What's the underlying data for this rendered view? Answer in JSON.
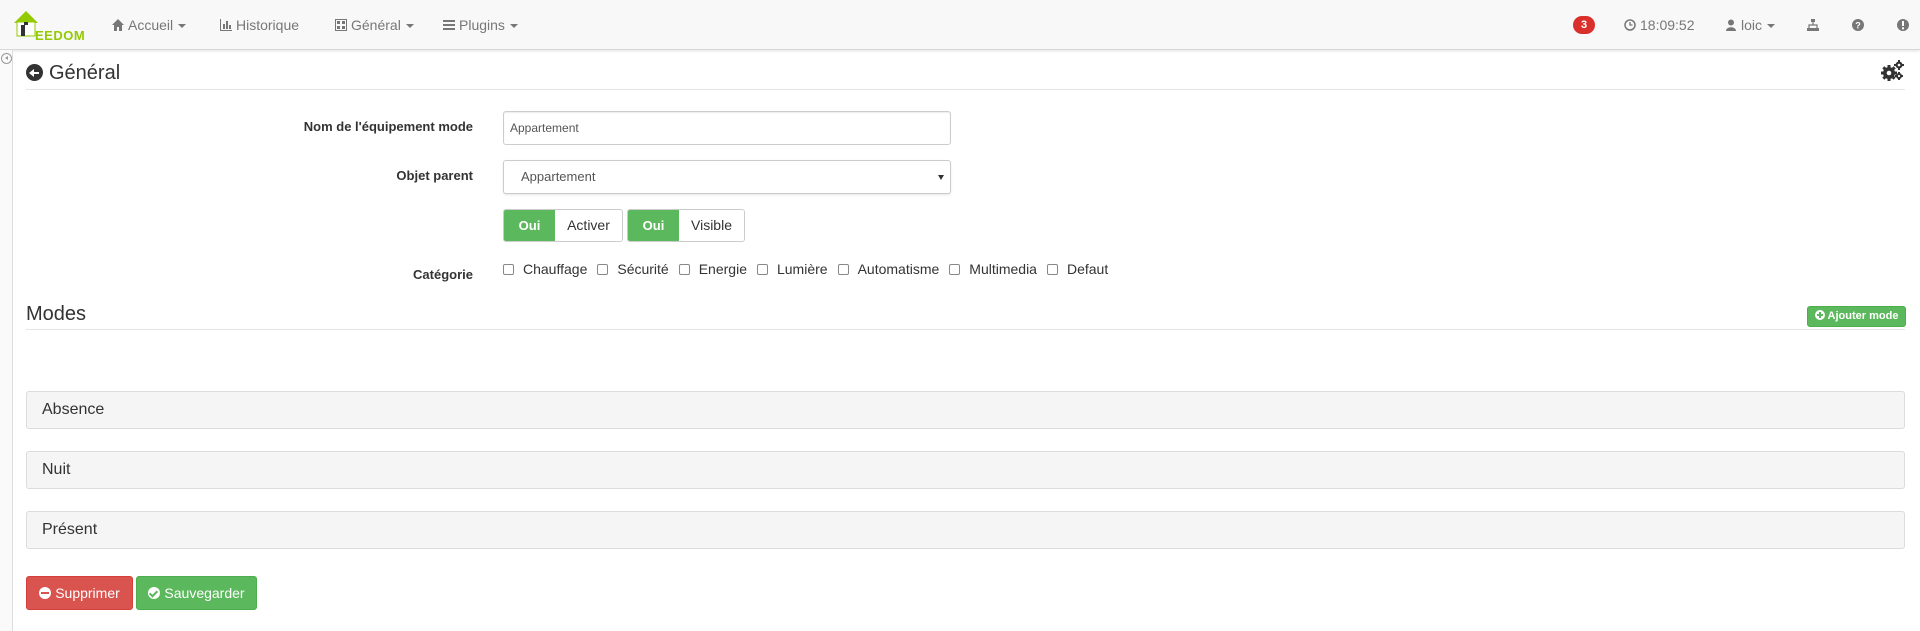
{
  "navbar": {
    "brand": "EEDOM",
    "accueil": "Accueil",
    "historique": "Historique",
    "general": "Général",
    "plugins": "Plugins",
    "notifications": "3",
    "time": "18:09:52",
    "user": "loic"
  },
  "page": {
    "title": "Général"
  },
  "form": {
    "name_label": "Nom de l'équipement mode",
    "name_value": "Appartement",
    "parent_label": "Objet parent",
    "parent_value": "Appartement",
    "toggle_enable": {
      "on": "Oui",
      "label": "Activer"
    },
    "toggle_visible": {
      "on": "Oui",
      "label": "Visible"
    },
    "category_label": "Catégorie",
    "categories": [
      "Chauffage",
      "Sécurité",
      "Energie",
      "Lumière",
      "Automatisme",
      "Multimedia",
      "Defaut"
    ]
  },
  "modes": {
    "title": "Modes",
    "add_button": "Ajouter mode",
    "items": [
      "Absence",
      "Nuit",
      "Présent"
    ]
  },
  "actions": {
    "delete": "Supprimer",
    "save": "Sauvegarder"
  },
  "colors": {
    "success": "#5cb85c",
    "danger": "#d9534f",
    "badge": "#d9302b",
    "brand": "#94ca02"
  }
}
